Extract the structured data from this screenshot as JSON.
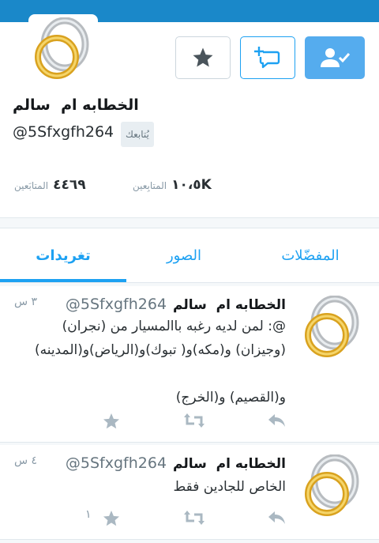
{
  "colors": {
    "topbar": "#1a88c9",
    "accent": "#1da1f2",
    "follow_button": "#55acee"
  },
  "profile": {
    "name": "الخطابه ام  سالم",
    "handle": "@5Sfxgfh264",
    "follows_you_label": "يُتابعك",
    "following_count": "٤٤٦٩",
    "following_label": "المتابَعين",
    "followers_count": "١٠،٥K",
    "followers_label": "المتابِعين",
    "buttons": {
      "favorite_icon": "star-icon",
      "message_icon": "message-add-icon",
      "follow_icon": "user-check-icon"
    }
  },
  "tabs": [
    {
      "label": "تغريدات",
      "active": true
    },
    {
      "label": "الصور",
      "active": false
    },
    {
      "label": "المفضّلات",
      "active": false
    }
  ],
  "tweets": [
    {
      "name": "الخطابه ام  سالم",
      "handle": "@5Sfxgfh264",
      "time": "٣ س",
      "text": "@: لمن لديه رغبه باالمسيار من (نجران)\n(وجيزان) و(مكه)و( تبوك)و(الرياض)و(المدينه)\n\nو(القصيم) و(الخرج)",
      "fav_count": ""
    },
    {
      "name": "الخطابه ام  سالم",
      "handle": "@5Sfxgfh264",
      "time": "٤ س",
      "text": "الخاص للجادين فقط",
      "fav_count": "١"
    }
  ]
}
